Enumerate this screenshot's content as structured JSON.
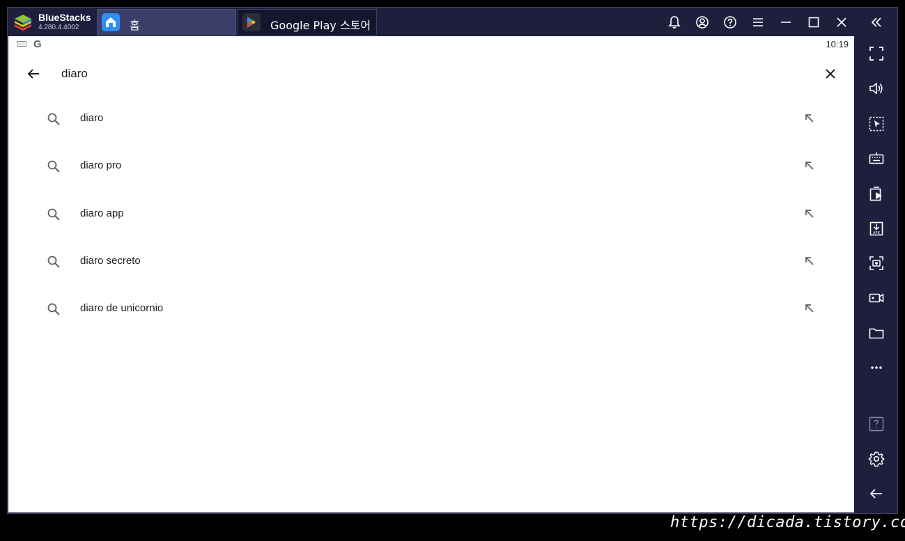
{
  "app": {
    "name": "BlueStacks",
    "version": "4.280.4.4002"
  },
  "tabs": [
    {
      "label": "홈",
      "icon": "home-icon"
    },
    {
      "label": "Google Play 스토어",
      "icon": "google-play-icon"
    }
  ],
  "topbar_icons": [
    "bell-icon",
    "account-icon",
    "help-icon",
    "menu-icon",
    "minimize-icon",
    "maximize-icon",
    "close-icon",
    "collapse-sidebar-icon"
  ],
  "sidebar_icons": [
    "fullscreen-icon",
    "volume-icon",
    "pointer-select-icon",
    "keyboard-icon",
    "multi-instance-icon",
    "apk-install-icon",
    "screenshot-icon",
    "record-icon",
    "folder-icon",
    "more-icon",
    "help-icon",
    "settings-icon",
    "back-icon"
  ],
  "status_bar": {
    "time": "10:19",
    "google_glyph": "G"
  },
  "search": {
    "query": "diaro"
  },
  "suggestions": [
    "diaro",
    "diaro pro",
    "diaro app",
    "diaro secreto",
    "diaro de unicornio"
  ],
  "watermark": "https://dicada.tistory.com",
  "colors": {
    "frame": "#1d1f3d",
    "active_tab": "#3a3e68",
    "screen": "#ffffff",
    "icon_gray": "#5f6368",
    "text_dark": "#202124"
  }
}
